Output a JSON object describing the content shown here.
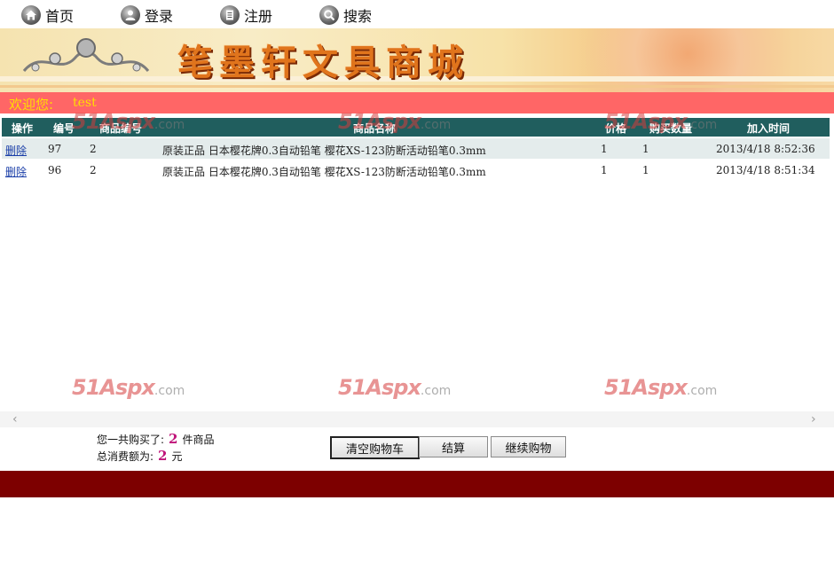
{
  "nav": {
    "items": [
      {
        "label": "首页",
        "icon": "home-icon"
      },
      {
        "label": "登录",
        "icon": "user-icon"
      },
      {
        "label": "注册",
        "icon": "document-icon"
      },
      {
        "label": "搜索",
        "icon": "search-icon"
      }
    ]
  },
  "banner": {
    "title": "笔墨轩文具商城"
  },
  "welcome": {
    "label": "欢迎您:",
    "user": "test"
  },
  "table": {
    "headers": [
      "操作",
      "编号",
      "商品编号",
      "商品名称",
      "价格",
      "购买数量",
      "加入时间"
    ],
    "rows": [
      {
        "action": "删除",
        "id": "97",
        "product_id": "2",
        "name": "原装正品 日本樱花牌0.3自动铅笔 樱花XS-123防断活动铅笔0.3mm",
        "price": "1",
        "qty": "1",
        "time": "2013/4/18 8:52:36"
      },
      {
        "action": "删除",
        "id": "96",
        "product_id": "2",
        "name": "原装正品 日本樱花牌0.3自动铅笔 樱花XS-123防断活动铅笔0.3mm",
        "price": "1",
        "qty": "1",
        "time": "2013/4/18 8:51:34"
      }
    ]
  },
  "watermark": {
    "brand": "51Aspx",
    "suffix": ".com"
  },
  "summary": {
    "count_prefix": "您一共购买了:",
    "count": "2",
    "count_suffix": "件商品",
    "total_prefix": "总消费额为:",
    "total": "2",
    "total_suffix": "元"
  },
  "buttons": {
    "clear": "清空购物车",
    "checkout": "结算",
    "continue": "继续购物"
  },
  "colors": {
    "welcome_bg": "#ff6666",
    "welcome_text": "#ffdf00",
    "table_header": "#205e5e",
    "footer": "#7d0000"
  }
}
